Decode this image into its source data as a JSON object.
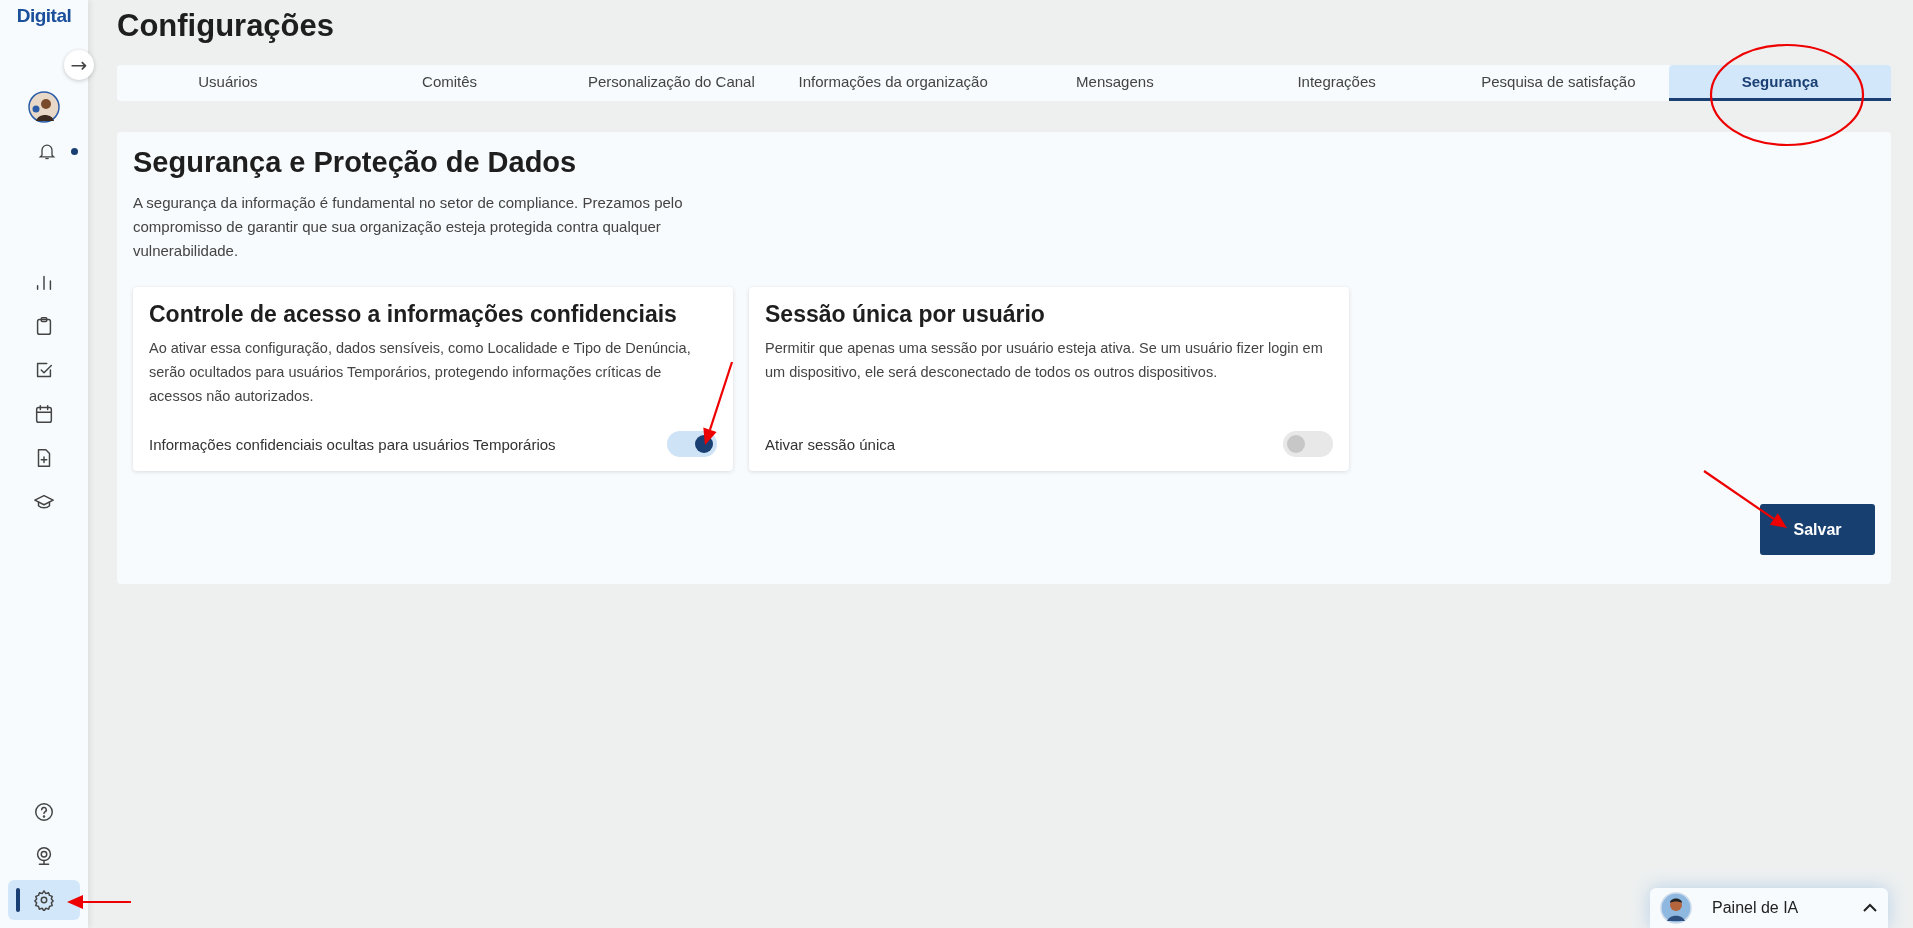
{
  "sidebar": {
    "logo": "Digital",
    "expand_button": "→",
    "notifications": {
      "unread": true
    },
    "nav_items": [
      {
        "kind": "chart",
        "selected": false
      },
      {
        "kind": "clipboard",
        "selected": false
      },
      {
        "kind": "checkbox",
        "selected": false
      },
      {
        "kind": "calendar",
        "selected": false
      },
      {
        "kind": "file-plus",
        "selected": false
      },
      {
        "kind": "graduation",
        "selected": false
      }
    ],
    "bottom_items": [
      {
        "kind": "help",
        "selected": false
      },
      {
        "kind": "webcam",
        "selected": false
      },
      {
        "kind": "settings",
        "selected": true
      }
    ]
  },
  "page": {
    "title": "Configurações"
  },
  "tabs": [
    {
      "label": "Usuários",
      "selected": false
    },
    {
      "label": "Comitês",
      "selected": false
    },
    {
      "label": "Personalização do Canal",
      "selected": false
    },
    {
      "label": "Informações da organização",
      "selected": false
    },
    {
      "label": "Mensagens",
      "selected": false
    },
    {
      "label": "Integrações",
      "selected": false
    },
    {
      "label": "Pesquisa de satisfação",
      "selected": false
    },
    {
      "label": "Segurança",
      "selected": true
    }
  ],
  "panel": {
    "title": "Segurança e Proteção de Dados",
    "description": "A segurança da informação é fundamental no setor de compliance. Prezamos pelo compromisso de garantir que sua organização esteja protegida contra qualquer vulnerabilidade.",
    "cards": [
      {
        "title": "Controle de acesso a informações confidenciais",
        "description": "Ao ativar essa configuração, dados sensíveis, como Localidade e Tipo de Denúncia, serão ocultados para usuários Temporários, protegendo informações críticas de acessos não autorizados.",
        "toggle_label": "Informações confidenciais ocultas para usuários Temporários",
        "on": true
      },
      {
        "title": "Sessão única por usuário",
        "description": "Permitir que apenas uma sessão por usuário esteja ativa. Se um usuário fizer login em um dispositivo, ele será desconectado de todos os outros dispositivos.",
        "toggle_label": "Ativar sessão única",
        "on": false
      }
    ],
    "save_button": "Salvar"
  },
  "ai_panel": {
    "label": "Painel de IA",
    "expanded": false
  },
  "annotations": [
    {
      "kind": "circle"
    },
    {
      "kind": "arrow"
    },
    {
      "kind": "arrow"
    },
    {
      "kind": "arrow"
    }
  ]
}
